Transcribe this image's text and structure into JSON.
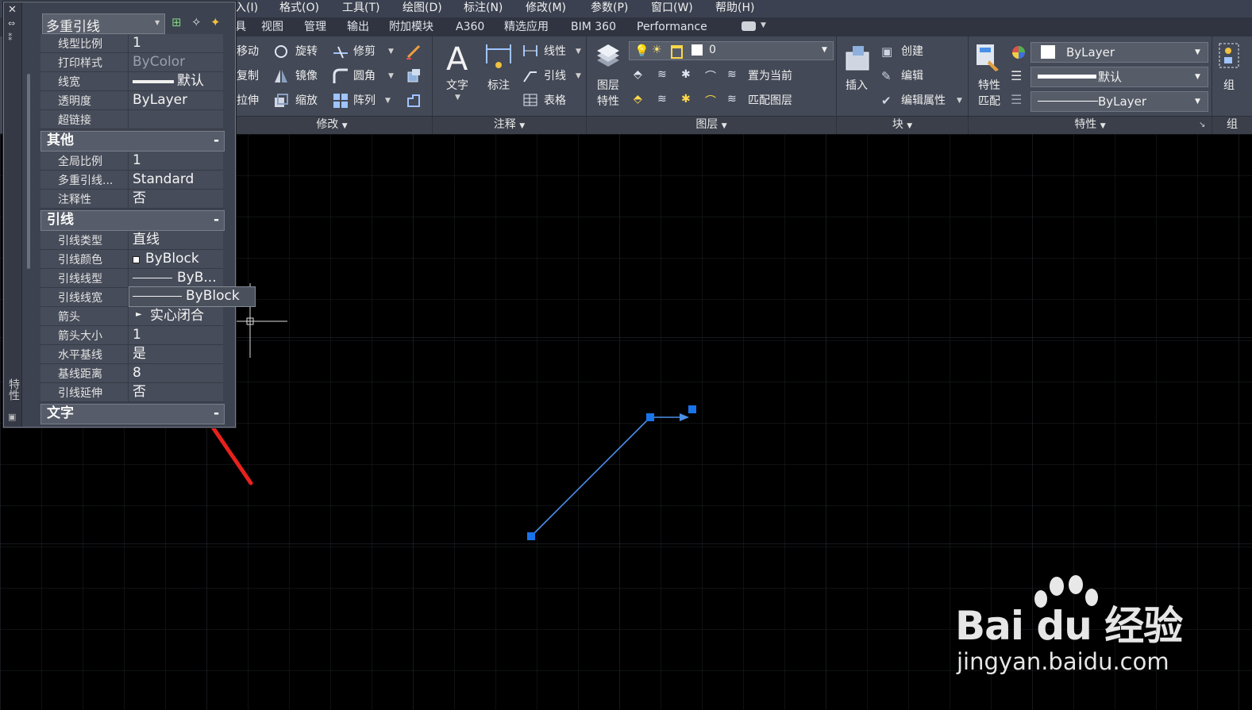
{
  "menubar": {
    "items": [
      "入(I)",
      "格式(O)",
      "工具(T)",
      "绘图(D)",
      "标注(N)",
      "修改(M)",
      "参数(P)",
      "窗口(W)",
      "帮助(H)"
    ]
  },
  "tabs": {
    "items": [
      "具",
      "视图",
      "管理",
      "输出",
      "附加模块",
      "A360",
      "精选应用",
      "BIM 360",
      "Performance"
    ]
  },
  "ribbon": {
    "modify": {
      "move": "移动",
      "rotate": "旋转",
      "trim": "修剪",
      "copy": "复制",
      "mirror": "镜像",
      "fillet": "圆角",
      "stretch": "拉伸",
      "scale": "缩放",
      "array": "阵列",
      "panel_title": "修改"
    },
    "annotation": {
      "text": "文字",
      "dimension": "标注",
      "linear": "线性",
      "leader": "引线",
      "table": "表格",
      "panel_title": "注释"
    },
    "layers": {
      "layer_props_line1": "图层",
      "layer_props_line2": "特性",
      "current_layer": "0",
      "set_current": "置为当前",
      "match_layer": "匹配图层",
      "panel_title": "图层"
    },
    "block": {
      "insert": "插入",
      "create": "创建",
      "edit": "编辑",
      "edit_attributes": "编辑属性",
      "panel_title": "块"
    },
    "properties": {
      "match_line1": "特性",
      "match_line2": "匹配",
      "color": "ByLayer",
      "lineweight": "默认",
      "linetype": "ByLayer",
      "panel_title": "特性"
    },
    "group": {
      "label": "组",
      "panel_title": "组"
    }
  },
  "palette": {
    "object_type": "多重引线",
    "side_title": "特性",
    "rows_top": [
      {
        "name": "线型比例",
        "value": "1"
      },
      {
        "name": "打印样式",
        "value": "ByColor"
      },
      {
        "name": "线宽",
        "value": "默认"
      },
      {
        "name": "透明度",
        "value": "ByLayer"
      },
      {
        "name": "超链接",
        "value": ""
      }
    ],
    "section_misc": "其他",
    "rows_misc": [
      {
        "name": "全局比例",
        "value": "1"
      },
      {
        "name": "多重引线...",
        "value": "Standard"
      },
      {
        "name": "注释性",
        "value": "否"
      }
    ],
    "section_leader": "引线",
    "rows_leader": [
      {
        "name": "引线类型",
        "value": "直线"
      },
      {
        "name": "引线颜色",
        "value": "ByBlock"
      },
      {
        "name": "引线线型",
        "value": "ByB..."
      },
      {
        "name": "引线线宽",
        "value": "ByBlock"
      },
      {
        "name": "箭头",
        "value": "实心闭合"
      },
      {
        "name": "箭头大小",
        "value": "1"
      },
      {
        "name": "水平基线",
        "value": "是"
      },
      {
        "name": "基线距离",
        "value": "8"
      },
      {
        "name": "引线延伸",
        "value": "否"
      }
    ],
    "section_text": "文字",
    "collapse_symbol": "-"
  },
  "watermark": {
    "brand": "Bai du 经验",
    "url": "jingyan.baidu.com"
  },
  "colors": {
    "leader_line": "#4a8fe8",
    "grip": "#1a73e8",
    "annotation_arrow": "#e8211d"
  }
}
